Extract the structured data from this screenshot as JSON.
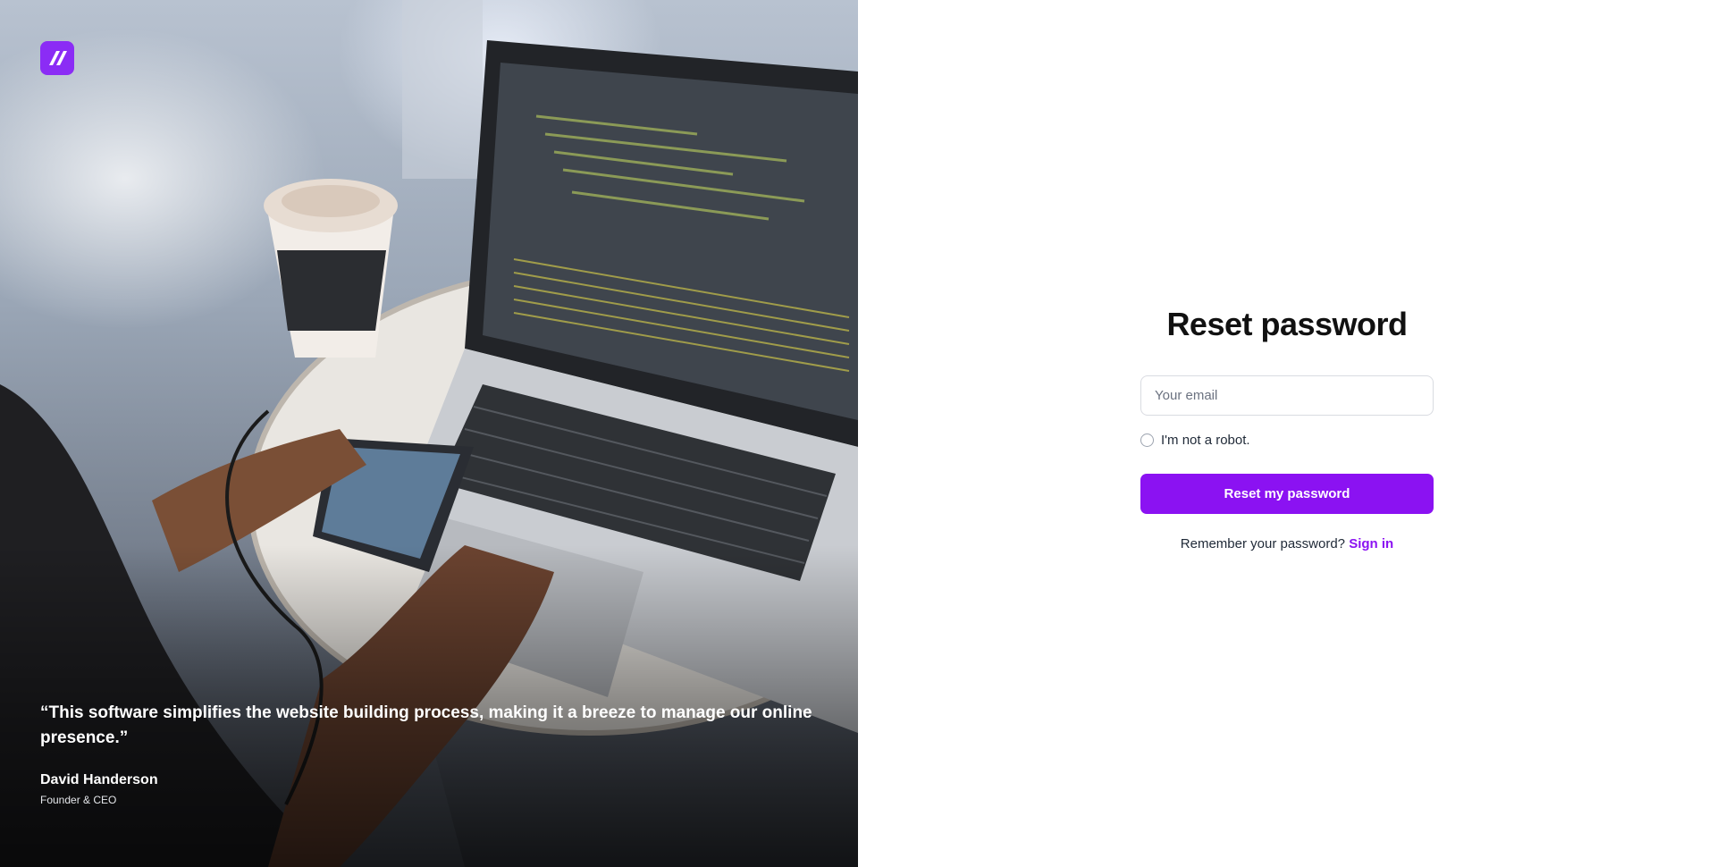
{
  "brand": {
    "accent": "#8b12f2",
    "logo_icon": "brand-logo-icon"
  },
  "hero": {
    "quote": "“This software simplifies the website building process, making it a breeze to manage our online presence.”",
    "author_name": "David Handerson",
    "author_role": "Founder & CEO"
  },
  "form": {
    "title": "Reset password",
    "email_placeholder": "Your email",
    "robot_label": "I'm not a robot.",
    "submit_label": "Reset my password",
    "remember_text": "Remember your password?",
    "signin_label": "Sign in"
  }
}
